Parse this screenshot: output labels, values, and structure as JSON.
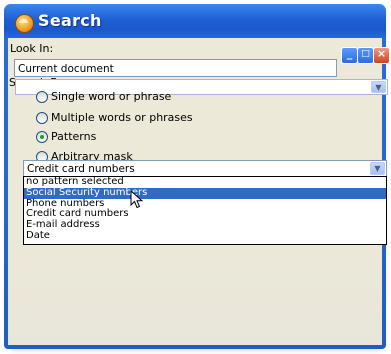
{
  "window": {
    "title": "Search"
  },
  "look_in": {
    "label": "Look In:",
    "value": "Current document"
  },
  "search_for": {
    "label": "Search For:",
    "options": [
      {
        "label": "Single word or phrase",
        "selected": false
      },
      {
        "label": "Multiple words or phrases",
        "selected": false
      },
      {
        "label": "Patterns",
        "selected": true
      },
      {
        "label": "Arbitrary mask",
        "selected": false
      }
    ]
  },
  "pattern": {
    "value": "Credit card numbers",
    "options": [
      "no pattern selected",
      "Social Security numbers",
      "Phone numbers",
      "Credit card numbers",
      "E-mail address",
      "Date"
    ],
    "highlighted_index": 1
  },
  "colors": {
    "accent": "#316ac5",
    "title_bar": "#1d5ed2",
    "client": "#ece9d8"
  }
}
